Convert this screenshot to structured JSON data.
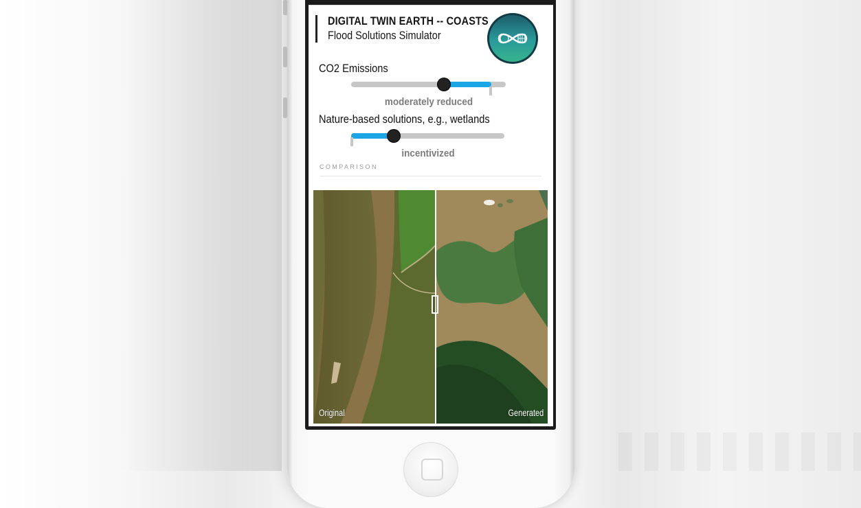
{
  "app": {
    "title": "DIGITAL TWIN EARTH -- COASTS",
    "subtitle": "Flood Solutions Simulator",
    "logo_text": "DIGITAL TWIN EARTH"
  },
  "controls": {
    "co2": {
      "label": "CO2 Emissions",
      "value_text": "moderately reduced",
      "level": 0.6
    },
    "nature": {
      "label": "Nature-based solutions, e.g., wetlands",
      "value_text": "incentivized",
      "level": 0.28
    }
  },
  "comparison": {
    "section_label": "COMPARISON",
    "left_caption": "Original",
    "right_caption": "Generated",
    "split": 0.52
  },
  "colors": {
    "accent": "#1aa6e4",
    "track": "#c7c7c7",
    "thumb": "#222222",
    "value_text": "#7c7c7c"
  }
}
